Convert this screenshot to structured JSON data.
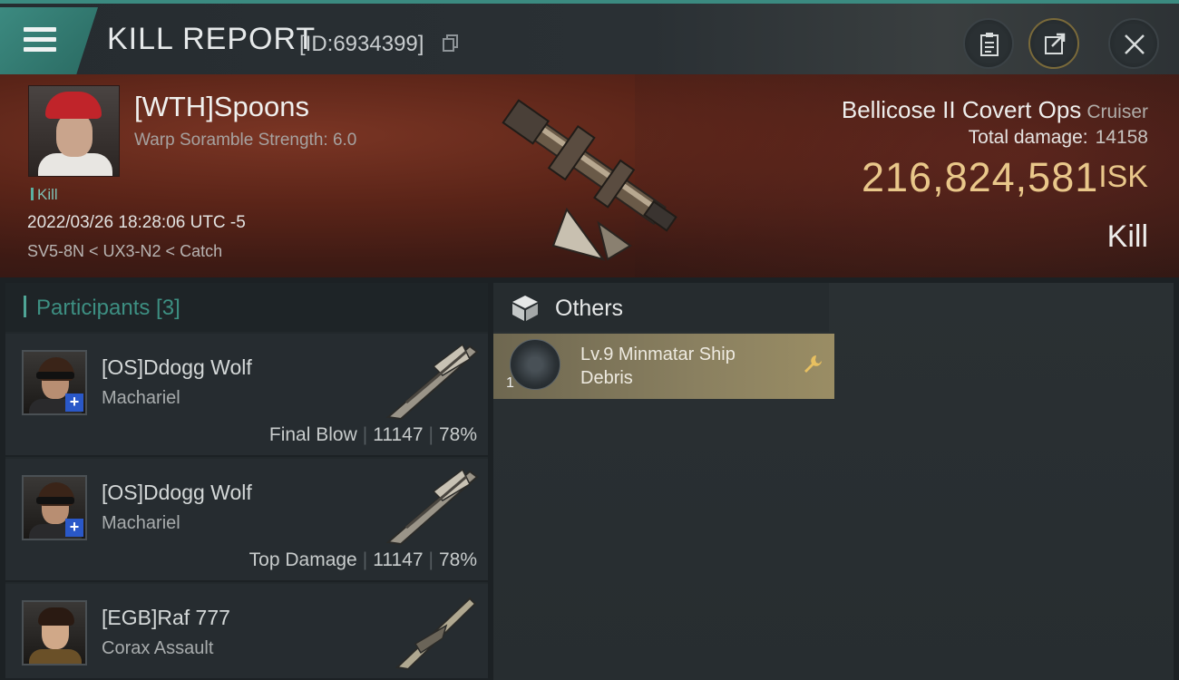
{
  "header": {
    "title": "KILL REPORT",
    "report_id": "[ID:6934399]"
  },
  "victim": {
    "name": "[WTH]Spoons",
    "scramble": "Warp Soramble Strength: 6.0",
    "kill_tag": "Kill",
    "datetime": "2022/03/26 18:28:06 UTC -5",
    "location": "SV5-8N < UX3-N2 < Catch"
  },
  "ship": {
    "name": "Bellicose II Covert Ops",
    "class": "Cruiser",
    "total_damage_label": "Total damage:",
    "total_damage": "14158",
    "isk_value": "216,824,581",
    "isk_unit": "ISK",
    "result": "Kill"
  },
  "participants": {
    "title": "Participants [3]",
    "rows": [
      {
        "name": "[OS]Ddogg Wolf",
        "ship": "Machariel",
        "role": "Final Blow",
        "damage": "11147",
        "percent": "78%"
      },
      {
        "name": "[OS]Ddogg Wolf",
        "ship": "Machariel",
        "role": "Top Damage",
        "damage": "11147",
        "percent": "78%"
      },
      {
        "name": "[EGB]Raf 777",
        "ship": "Corax Assault"
      }
    ]
  },
  "others": {
    "title": "Others",
    "items": [
      {
        "name": "Lv.9 Minmatar Ship Debris",
        "quantity": "1"
      }
    ]
  },
  "colors": {
    "accent_teal": "#3b8a80",
    "isk_gold": "#e9c78a",
    "banner_red": "#5a2418"
  },
  "icons": [
    "menu-icon",
    "copy-icon",
    "clipboard-icon",
    "share-icon",
    "close-icon",
    "cube-icon",
    "wrench-icon"
  ]
}
